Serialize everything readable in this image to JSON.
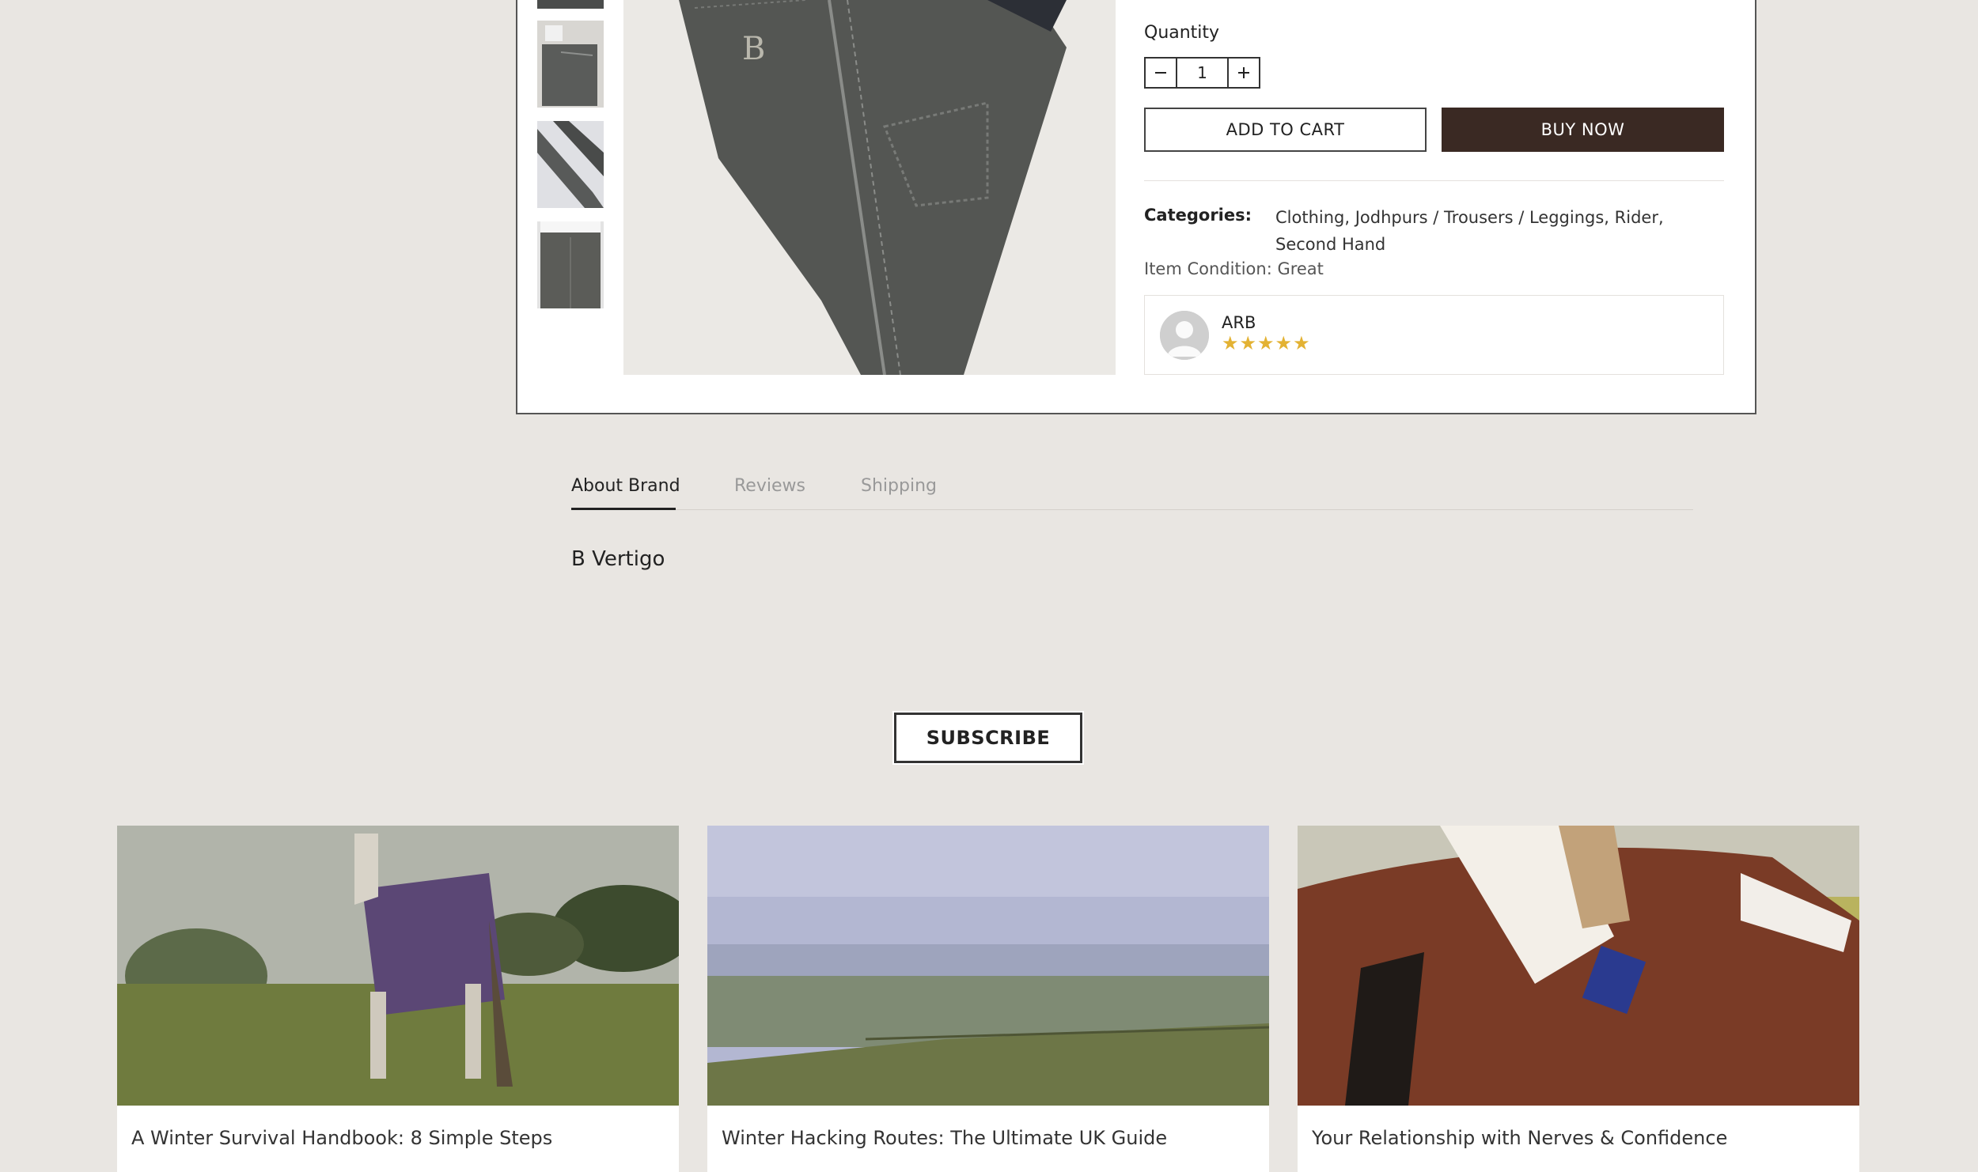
{
  "product": {
    "quantity_label": "Quantity",
    "quantity_value": "1",
    "minus_icon": "minus-icon",
    "plus_icon": "plus-icon",
    "add_to_cart": "ADD TO CART",
    "buy_now": "BUY NOW",
    "categories_label": "Categories:",
    "categories_value": "Clothing, Jodhpurs / Trousers / Leggings, Rider, Second Hand",
    "condition": "Item Condition: Great",
    "seller": {
      "name": "ARB",
      "rating": 5,
      "stars": "★★★★★",
      "avatar_icon": "user-avatar-icon"
    }
  },
  "tabs": [
    {
      "label": "About Brand",
      "active": true
    },
    {
      "label": "Reviews",
      "active": false
    },
    {
      "label": "Shipping",
      "active": false
    }
  ],
  "brand_name": "B Vertigo",
  "subscribe_label": "SUBSCRIBE",
  "blog_posts": [
    {
      "title": "A Winter Survival Handbook: 8 Simple Steps"
    },
    {
      "title": "Winter Hacking Routes: The Ultimate UK Guide"
    },
    {
      "title": "Your Relationship with Nerves & Confidence"
    }
  ],
  "colors": {
    "page_background": "#e9e6e2",
    "buy_now_background": "#3a2923",
    "star_color": "#e3b233"
  }
}
